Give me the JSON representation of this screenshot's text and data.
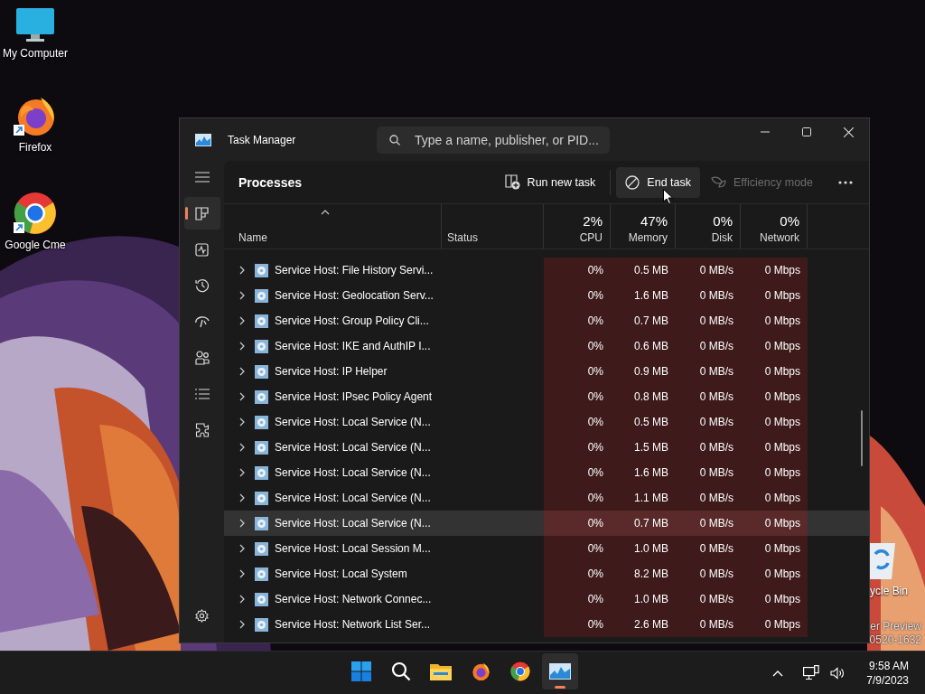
{
  "desktop": {
    "icons": [
      {
        "kind": "computer",
        "label": "My Computer",
        "shortcut": false
      },
      {
        "kind": "firefox",
        "label": "Firefox",
        "shortcut": true
      },
      {
        "kind": "chrome",
        "label": "Google Cme",
        "shortcut": true
      }
    ],
    "recycle_label": "ycle Bin",
    "watermark": [
      "er Preview",
      "0520-1632"
    ]
  },
  "window": {
    "title": "Task Manager",
    "search": {
      "placeholder": "Type a name, publisher, or PID..."
    }
  },
  "nav": [
    {
      "kind": "menu",
      "selected": false
    },
    {
      "kind": "processes",
      "selected": true
    },
    {
      "kind": "performance",
      "selected": false
    },
    {
      "kind": "history",
      "selected": false
    },
    {
      "kind": "startup",
      "selected": false
    },
    {
      "kind": "users",
      "selected": false
    },
    {
      "kind": "details",
      "selected": false
    },
    {
      "kind": "services",
      "selected": false
    },
    {
      "kind": "settings",
      "selected": false
    }
  ],
  "page_title": "Processes",
  "toolbar": [
    {
      "kind": "run",
      "label": "Run new task",
      "disabled": false,
      "hovered": false
    },
    {
      "kind": "end",
      "label": "End task",
      "disabled": false,
      "hovered": true
    },
    {
      "kind": "efficiency",
      "label": "Efficiency mode",
      "disabled": true,
      "hovered": false
    }
  ],
  "columns": [
    {
      "label": "Name"
    },
    {
      "label": "Status"
    },
    {
      "label": "CPU",
      "total": "2%"
    },
    {
      "label": "Memory",
      "total": "47%"
    },
    {
      "label": "Disk",
      "total": "0%"
    },
    {
      "label": "Network",
      "total": "0%"
    }
  ],
  "rows": [
    {
      "name": "Service Host: File History Servi...",
      "cpu": "0%",
      "memory": "0.5 MB",
      "disk": "0 MB/s",
      "network": "0 Mbps",
      "selected": false
    },
    {
      "name": "Service Host: Geolocation Serv...",
      "cpu": "0%",
      "memory": "1.6 MB",
      "disk": "0 MB/s",
      "network": "0 Mbps",
      "selected": false
    },
    {
      "name": "Service Host: Group Policy Cli...",
      "cpu": "0%",
      "memory": "0.7 MB",
      "disk": "0 MB/s",
      "network": "0 Mbps",
      "selected": false
    },
    {
      "name": "Service Host: IKE and AuthIP I...",
      "cpu": "0%",
      "memory": "0.6 MB",
      "disk": "0 MB/s",
      "network": "0 Mbps",
      "selected": false
    },
    {
      "name": "Service Host: IP Helper",
      "cpu": "0%",
      "memory": "0.9 MB",
      "disk": "0 MB/s",
      "network": "0 Mbps",
      "selected": false
    },
    {
      "name": "Service Host: IPsec Policy Agent",
      "cpu": "0%",
      "memory": "0.8 MB",
      "disk": "0 MB/s",
      "network": "0 Mbps",
      "selected": false
    },
    {
      "name": "Service Host: Local Service (N...",
      "cpu": "0%",
      "memory": "0.5 MB",
      "disk": "0 MB/s",
      "network": "0 Mbps",
      "selected": false
    },
    {
      "name": "Service Host: Local Service (N...",
      "cpu": "0%",
      "memory": "1.5 MB",
      "disk": "0 MB/s",
      "network": "0 Mbps",
      "selected": false
    },
    {
      "name": "Service Host: Local Service (N...",
      "cpu": "0%",
      "memory": "1.6 MB",
      "disk": "0 MB/s",
      "network": "0 Mbps",
      "selected": false
    },
    {
      "name": "Service Host: Local Service (N...",
      "cpu": "0%",
      "memory": "1.1 MB",
      "disk": "0 MB/s",
      "network": "0 Mbps",
      "selected": false
    },
    {
      "name": "Service Host: Local Service (N...",
      "cpu": "0%",
      "memory": "0.7 MB",
      "disk": "0 MB/s",
      "network": "0 Mbps",
      "selected": true
    },
    {
      "name": "Service Host: Local Session M...",
      "cpu": "0%",
      "memory": "1.0 MB",
      "disk": "0 MB/s",
      "network": "0 Mbps",
      "selected": false
    },
    {
      "name": "Service Host: Local System",
      "cpu": "0%",
      "memory": "8.2 MB",
      "disk": "0 MB/s",
      "network": "0 Mbps",
      "selected": false
    },
    {
      "name": "Service Host: Network Connec...",
      "cpu": "0%",
      "memory": "1.0 MB",
      "disk": "0 MB/s",
      "network": "0 Mbps",
      "selected": false
    },
    {
      "name": "Service Host: Network List Ser...",
      "cpu": "0%",
      "memory": "2.6 MB",
      "disk": "0 MB/s",
      "network": "0 Mbps",
      "selected": false
    }
  ],
  "taskbar": {
    "apps": [
      {
        "kind": "start",
        "active": false
      },
      {
        "kind": "search",
        "active": false
      },
      {
        "kind": "files",
        "active": false
      },
      {
        "kind": "firefox",
        "active": false
      },
      {
        "kind": "chrome",
        "active": false
      },
      {
        "kind": "taskmanager",
        "active": true
      }
    ],
    "time": "9:58 AM",
    "date": "7/9/2023"
  }
}
